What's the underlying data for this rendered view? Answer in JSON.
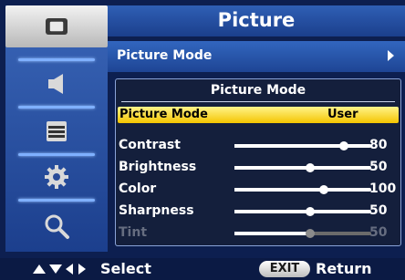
{
  "header": {
    "title": "Picture"
  },
  "sidebar": {
    "items": [
      {
        "icon": "picture-icon",
        "active": true
      },
      {
        "icon": "speaker-icon",
        "active": false
      },
      {
        "icon": "list-icon",
        "active": false
      },
      {
        "icon": "gear-icon",
        "active": false
      },
      {
        "icon": "search-icon",
        "active": false
      }
    ]
  },
  "menu": {
    "picture_mode_label": "Picture Mode"
  },
  "panel": {
    "title": "Picture Mode",
    "selected_row": {
      "label": "Picture Mode",
      "value": "User"
    },
    "sliders": [
      {
        "label": "Contrast",
        "value": "80",
        "level": 0.8,
        "enabled": true
      },
      {
        "label": "Brightness",
        "value": "50",
        "level": 0.55,
        "enabled": true
      },
      {
        "label": "Color",
        "value": "100",
        "level": 0.65,
        "enabled": true
      },
      {
        "label": "Sharpness",
        "value": "50",
        "level": 0.55,
        "enabled": true
      },
      {
        "label": "Tint",
        "value": "50",
        "level": 0.55,
        "enabled": false
      }
    ]
  },
  "footer": {
    "select_label": "Select",
    "exit_label": "EXIT",
    "return_label": "Return"
  },
  "colors": {
    "highlight": "#f4c400",
    "panel_bg": "#141f3c",
    "accent": "#2f5fb5"
  }
}
